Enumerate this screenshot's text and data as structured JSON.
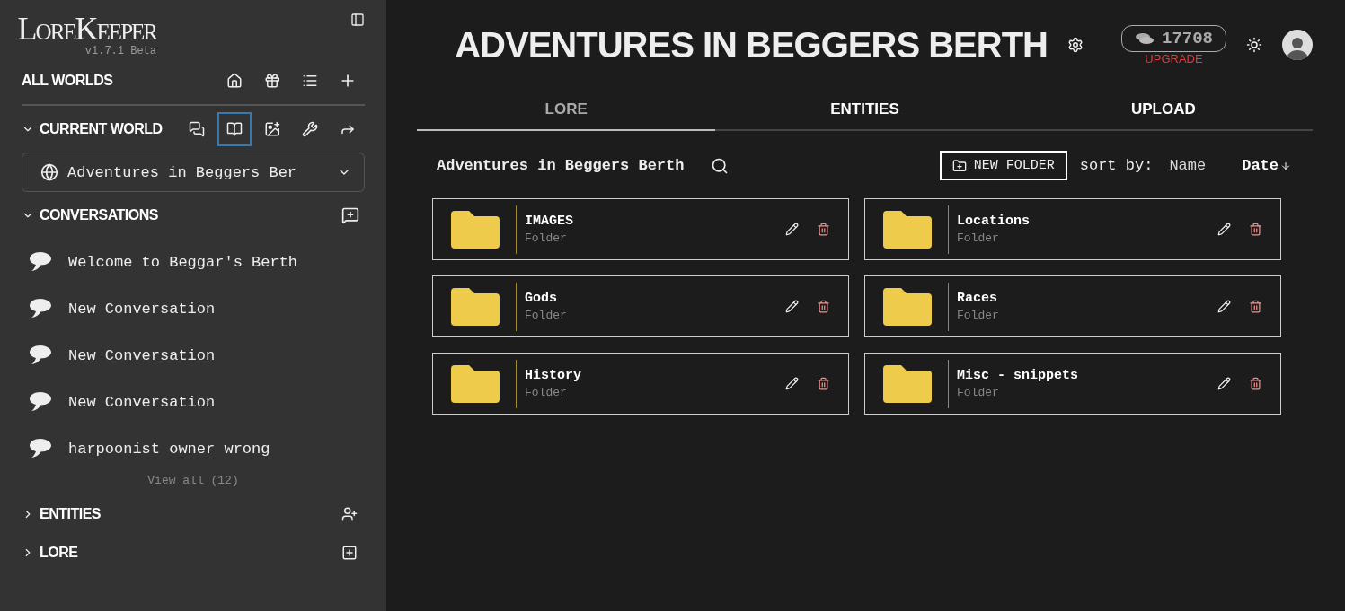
{
  "sidebar": {
    "logo": "LoreKeeper",
    "version": "v1.7.1 Beta",
    "all_worlds": {
      "label": "ALL WORLDS"
    },
    "current_world": {
      "label": "CURRENT WORLD",
      "expanded": true,
      "tools": [
        {
          "selected": false
        },
        {
          "selected": true
        },
        {
          "selected": false
        },
        {
          "selected": false
        },
        {
          "selected": false
        }
      ],
      "world_select": {
        "value": "Adventures in Beggers Ber"
      }
    },
    "conversations": {
      "label": "CONVERSATIONS",
      "expanded": true,
      "items": [
        "Welcome to Beggar's Berth",
        "New Conversation",
        "New Conversation",
        "New Conversation",
        "harpoonist owner wrong"
      ],
      "view_all": "View all (12)"
    },
    "entities": {
      "label": "ENTITIES",
      "expanded": false
    },
    "lore": {
      "label": "LORE",
      "expanded": false
    }
  },
  "header": {
    "title": "ADVENTURES IN BEGGERS BERTH",
    "credits": "17708",
    "upgrade": "UPGRADE"
  },
  "tabs": [
    {
      "label": "LORE",
      "selected": true
    },
    {
      "label": "ENTITIES",
      "selected": false
    },
    {
      "label": "UPLOAD",
      "selected": false
    }
  ],
  "toolbar": {
    "path": "Adventures in Beggers Berth",
    "new_folder": "NEW FOLDER",
    "sort_label": "sort by:",
    "sort_options": [
      {
        "label": "Name",
        "selected": false
      },
      {
        "label": "Date",
        "selected": true
      }
    ]
  },
  "folders": [
    {
      "name": "IMAGES",
      "type": "Folder"
    },
    {
      "name": "Locations",
      "type": "Folder"
    },
    {
      "name": "Gods",
      "type": "Folder"
    },
    {
      "name": "Races",
      "type": "Folder"
    },
    {
      "name": "History",
      "type": "Folder"
    },
    {
      "name": "Misc - snippets",
      "type": "Folder"
    }
  ]
}
